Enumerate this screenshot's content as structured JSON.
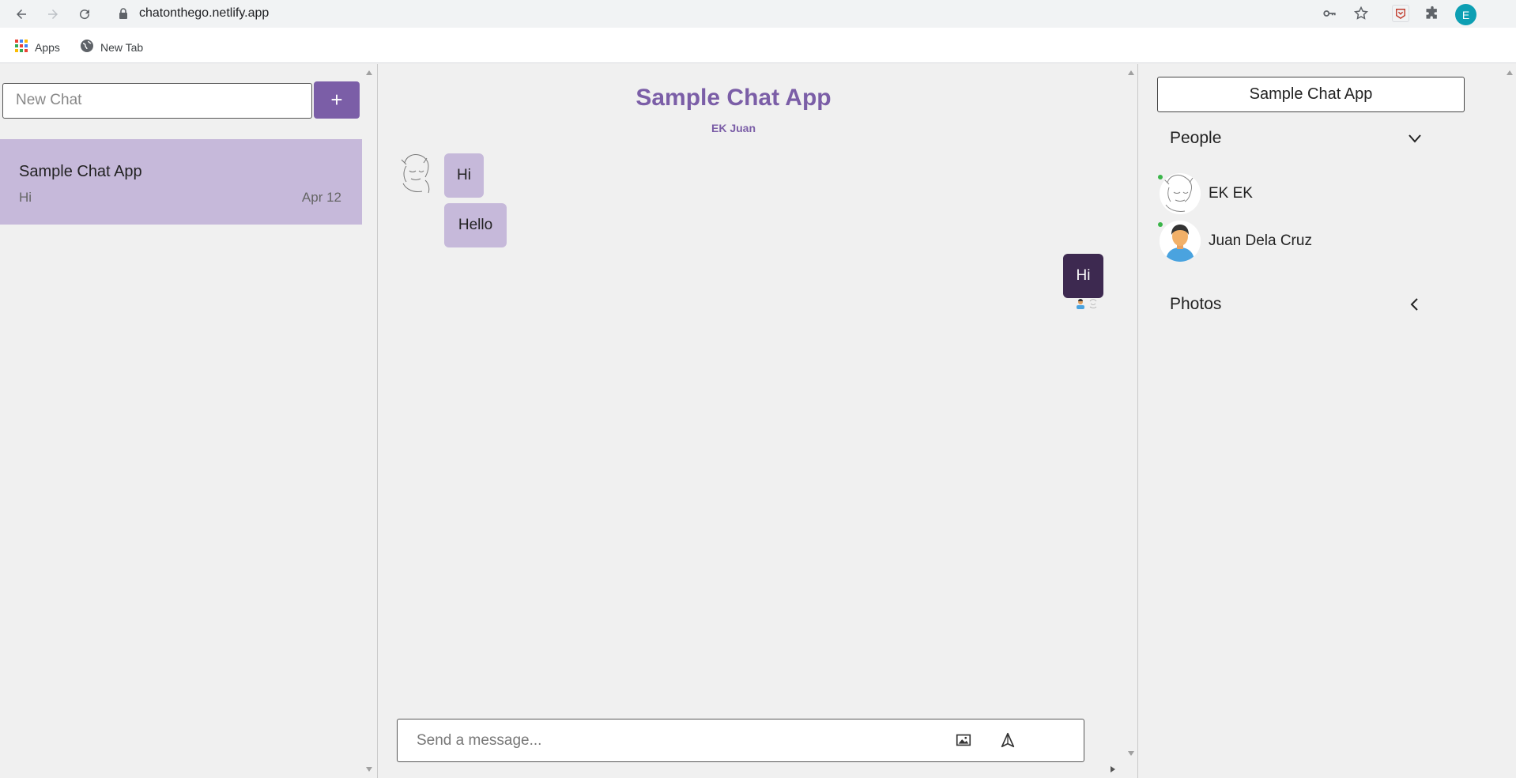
{
  "browser": {
    "url": "chatonthego.netlify.app",
    "profile_initial": "E",
    "bookmarks": [
      {
        "label": "Apps"
      },
      {
        "label": "New Tab"
      }
    ]
  },
  "left_panel": {
    "new_chat_placeholder": "New Chat",
    "new_chat_button": "+",
    "chats": [
      {
        "title": "Sample Chat App",
        "last_message": "Hi",
        "date": "Apr 12"
      }
    ]
  },
  "chat": {
    "title": "Sample Chat App",
    "members": "EK Juan",
    "messages": [
      {
        "text": "Hi",
        "direction": "in"
      },
      {
        "text": "Hello",
        "direction": "in"
      },
      {
        "text": "Hi",
        "direction": "out"
      }
    ],
    "composer_placeholder": "Send a message..."
  },
  "right_panel": {
    "chat_title": "Sample Chat App",
    "people_label": "People",
    "people": [
      {
        "name": "EK EK",
        "online": true
      },
      {
        "name": "Juan Dela Cruz",
        "online": true
      }
    ],
    "photos_label": "Photos"
  },
  "colors": {
    "accent": "#7b5ea7",
    "bubble_in": "#c6b9da",
    "bubble_out": "#3d2950",
    "online": "#3bb54a"
  }
}
